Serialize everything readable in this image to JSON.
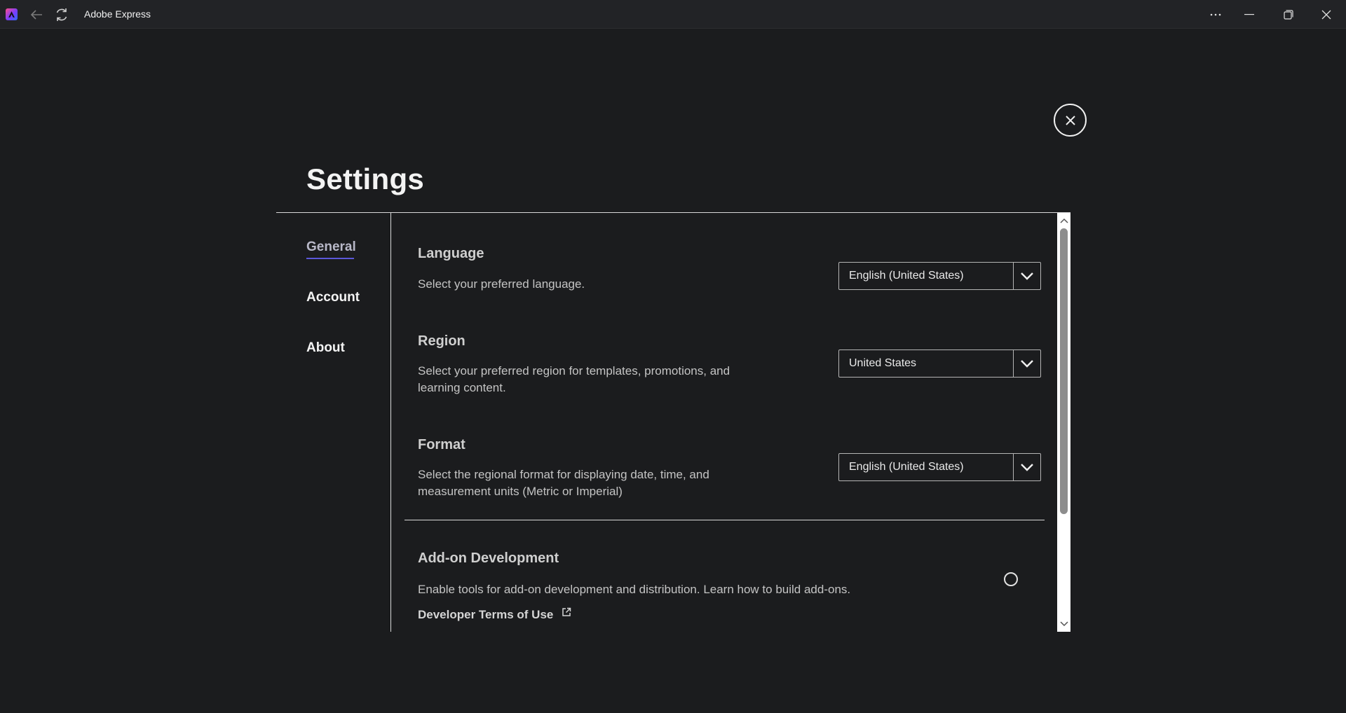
{
  "titlebar": {
    "app_title": "Adobe Express",
    "icons": {
      "logo": "adobe-express-logo",
      "back": "back-arrow-icon",
      "refresh": "refresh-icon",
      "more": "more-horizontal-icon",
      "minimize": "minimize-icon",
      "maximize": "restore-icon",
      "close": "close-icon"
    }
  },
  "settings": {
    "title": "Settings",
    "nav": {
      "general": "General",
      "account": "Account",
      "about": "About",
      "active": "General",
      "active_color": "#5b57d9"
    },
    "language": {
      "heading": "Language",
      "description": "Select your preferred language.",
      "value": "English (United States)"
    },
    "region": {
      "heading": "Region",
      "description": "Select your preferred region for templates, promotions, and learning content.",
      "value": "United States"
    },
    "format": {
      "heading": "Format",
      "description": "Select the regional format for displaying date, time, and measurement units (Metric or Imperial)",
      "value": "English (United States)"
    },
    "addon": {
      "heading": "Add-on Development",
      "description": "Enable tools for add-on development and distribution. Learn how to build add-ons.",
      "enabled": false,
      "terms_link": "Developer Terms of Use"
    }
  }
}
